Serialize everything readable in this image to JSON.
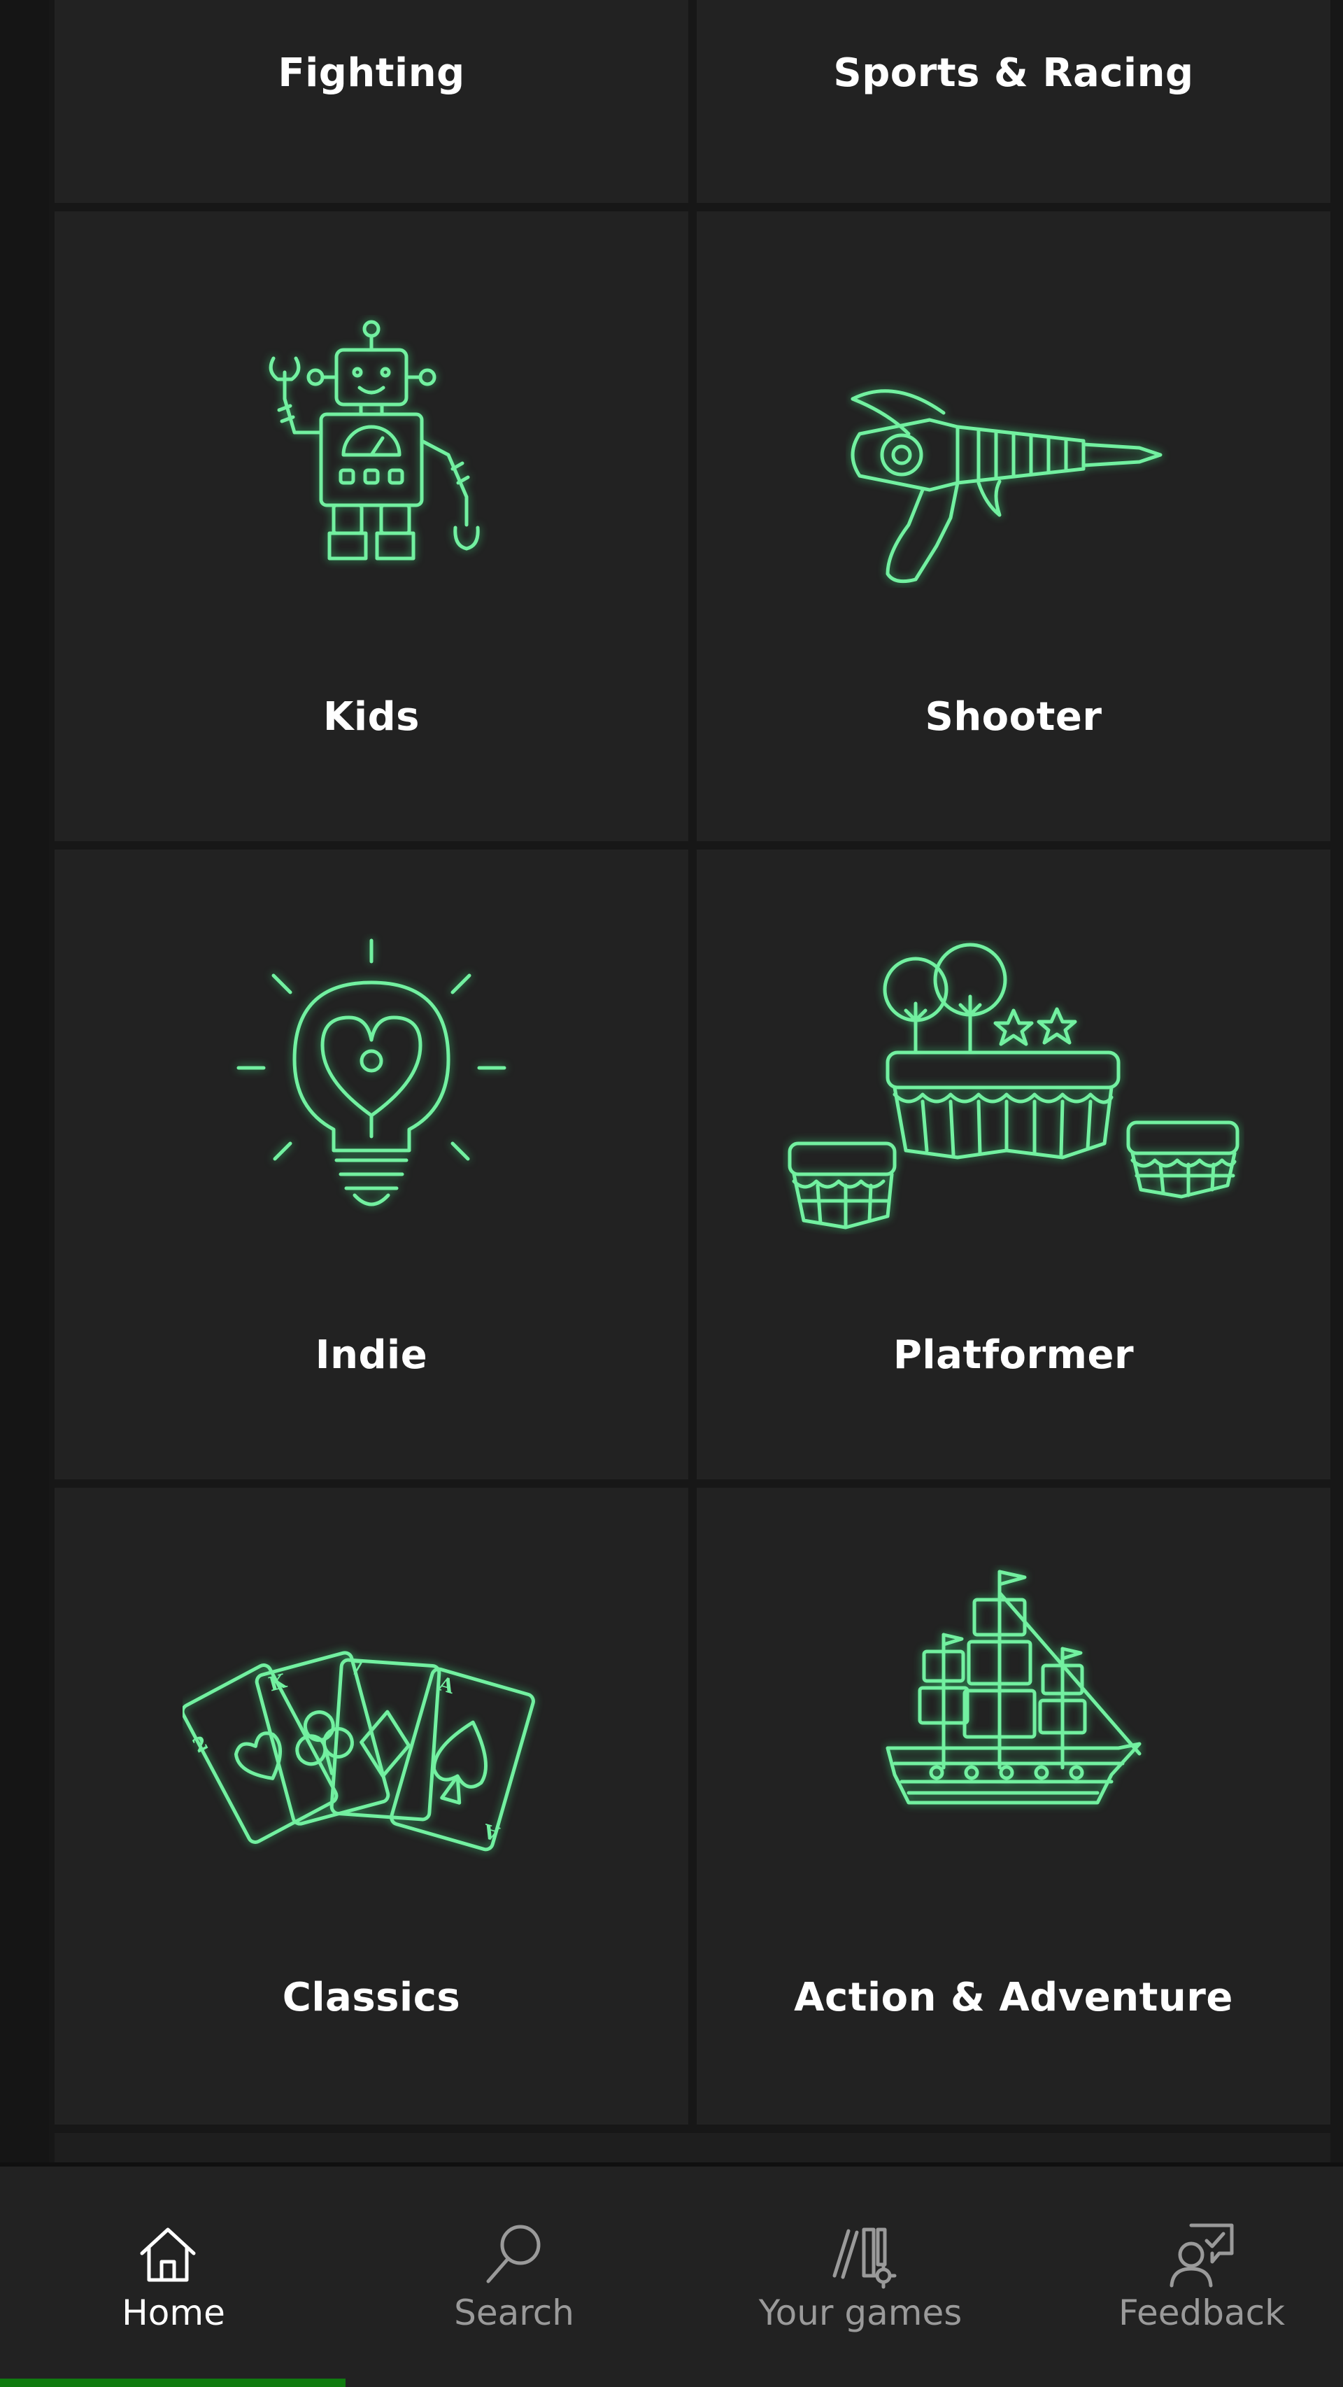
{
  "categories": [
    {
      "id": "fighting",
      "label": "Fighting",
      "icon": ""
    },
    {
      "id": "sports-racing",
      "label": "Sports & Racing",
      "icon": ""
    },
    {
      "id": "kids",
      "label": "Kids",
      "icon": "robot-icon"
    },
    {
      "id": "shooter",
      "label": "Shooter",
      "icon": "ray-gun-icon"
    },
    {
      "id": "indie",
      "label": "Indie",
      "icon": "lightbulb-heart-icon"
    },
    {
      "id": "platformer",
      "label": "Platformer",
      "icon": "floating-islands-icon"
    },
    {
      "id": "classics",
      "label": "Classics",
      "icon": "playing-cards-icon"
    },
    {
      "id": "action-adventure",
      "label": "Action & Adventure",
      "icon": "pirate-ship-icon"
    }
  ],
  "cards": {
    "card1": "2",
    "card2": "K",
    "card3": "7",
    "card4": "A",
    "card4_bottom": "A"
  },
  "nav": {
    "items": [
      {
        "id": "home",
        "label": "Home",
        "icon": "home-icon",
        "active": true
      },
      {
        "id": "search",
        "label": "Search",
        "icon": "search-icon",
        "active": false
      },
      {
        "id": "your-games",
        "label": "Your games",
        "icon": "library-icon",
        "active": false
      },
      {
        "id": "feedback",
        "label": "Feedback",
        "icon": "feedback-icon",
        "active": false
      }
    ]
  },
  "colors": {
    "accent": "#107c10",
    "icon_glow": "#72f0a0",
    "tile": "#222222",
    "background": "#171717"
  }
}
